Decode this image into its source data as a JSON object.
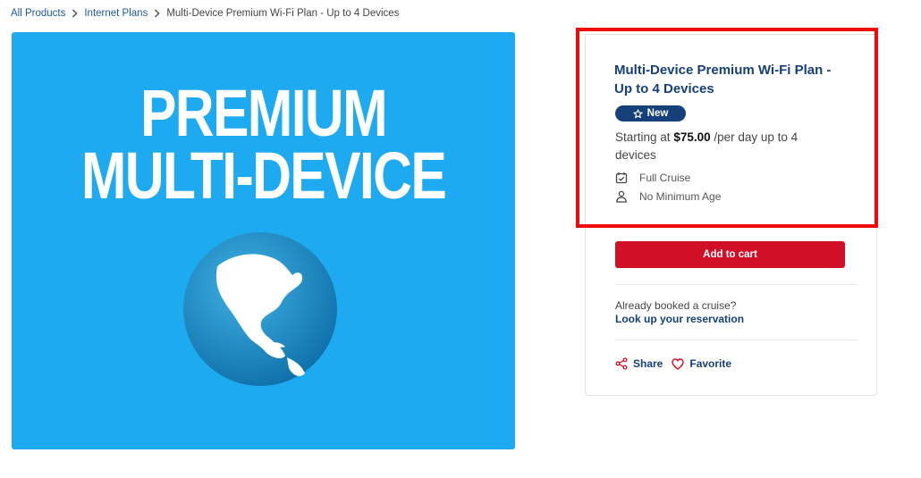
{
  "breadcrumb": {
    "items": [
      "All Products",
      "Internet Plans"
    ],
    "current": "Multi-Device Premium Wi-Fi Plan - Up to 4 Devices"
  },
  "hero": {
    "line1": "PREMIUM",
    "line2": "MULTI-DEVICE",
    "background_color": "#1daaf0",
    "globe_icon": "globe-americas"
  },
  "product": {
    "title": "Multi-Device Premium Wi-Fi Plan - Up to 4 Devices",
    "badge": "New",
    "badge_icon": "star-outline-icon",
    "price_prefix": "Starting at",
    "price": "$75.00",
    "price_suffix": "/per day up to 4 devices",
    "features": [
      {
        "icon": "calendar-check-icon",
        "label": "Full Cruise"
      },
      {
        "icon": "person-icon",
        "label": "No Minimum Age"
      }
    ]
  },
  "cart": {
    "label": "Add to cart",
    "color": "#d10f26"
  },
  "reservation": {
    "question": "Already booked a cruise?",
    "link": "Look up your reservation"
  },
  "actions": {
    "share": "Share",
    "favorite": "Favorite"
  },
  "colors": {
    "accent": "#16407a",
    "link": "#1c5a9c",
    "highlight": "#f00a0a"
  }
}
